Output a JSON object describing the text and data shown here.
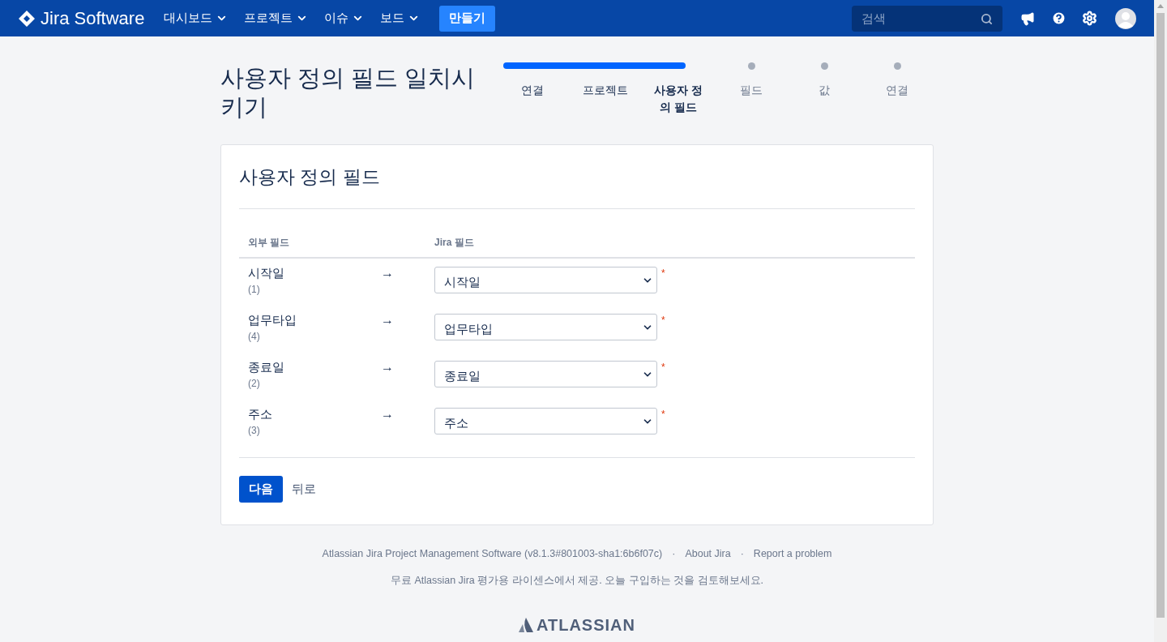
{
  "header": {
    "logo": "Jira Software",
    "nav": [
      {
        "label": "대시보드"
      },
      {
        "label": "프로젝트"
      },
      {
        "label": "이슈"
      },
      {
        "label": "보드"
      }
    ],
    "create_button": "만들기",
    "search": {
      "placeholder": "검색"
    }
  },
  "page_title": "사용자 정의 필드 일치시키기",
  "steps": [
    {
      "label": "연결",
      "done": true,
      "selected": false
    },
    {
      "label": "프로젝트",
      "done": true,
      "selected": false
    },
    {
      "label": "사용자 정의 필드",
      "done": true,
      "selected": true
    },
    {
      "label": "필드",
      "done": false,
      "selected": false
    },
    {
      "label": "값",
      "done": false,
      "selected": false
    },
    {
      "label": "연결",
      "done": false,
      "selected": false
    }
  ],
  "card": {
    "title": "사용자 정의 필드",
    "columns": [
      "외부 필드",
      "Jira 필드"
    ],
    "rows": [
      {
        "name": "시작일",
        "count": "(1)",
        "arrow": "→",
        "value": "시작일",
        "required": true
      },
      {
        "name": "업무타입",
        "count": "(4)",
        "arrow": "→",
        "value": "업무타입",
        "required": true
      },
      {
        "name": "종료일",
        "count": "(2)",
        "arrow": "→",
        "value": "종료일",
        "required": true
      },
      {
        "name": "주소",
        "count": "(3)",
        "arrow": "→",
        "value": "주소",
        "required": true
      }
    ],
    "required_mark": "*",
    "next_button": "다음",
    "back_link": "뒤로"
  },
  "footer": {
    "links": [
      "Atlassian Jira Project Management Software (v8.1.3#801003-sha1:6b6f07c)",
      "About Jira",
      "Report a problem"
    ],
    "separator": "·",
    "license": "무료 Atlassian Jira 평가용 라이센스에서 제공. 오늘 구입하는 것을 검토해보세요.",
    "logo": "ATLASSIAN"
  }
}
